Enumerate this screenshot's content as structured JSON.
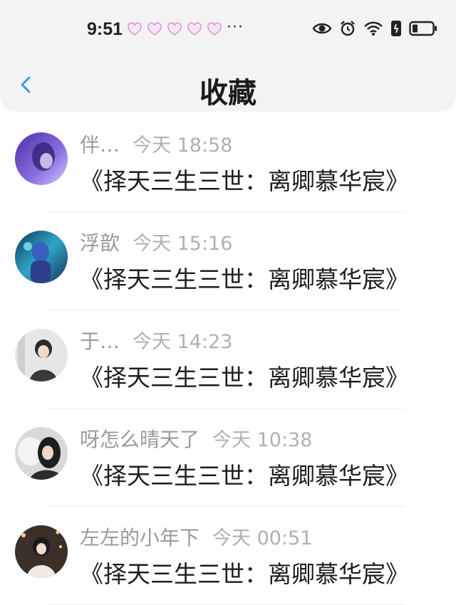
{
  "status_bar": {
    "time": "9:51",
    "more": "···",
    "icons": [
      "eye-icon",
      "alarm-icon",
      "wifi-icon",
      "sim-icon",
      "battery-icon"
    ]
  },
  "header": {
    "title": "收藏",
    "back_icon": "chevron-left-icon",
    "accent": "#3a9bdc"
  },
  "items": [
    {
      "name": "伴…",
      "time": "今天 18:58",
      "content": "《择天三生三世：离卿慕华宸》"
    },
    {
      "name": "浮歆",
      "time": "今天 15:16",
      "content": "《择天三生三世：离卿慕华宸》"
    },
    {
      "name": "于…",
      "time": "今天 14:23",
      "content": "《择天三生三世：离卿慕华宸》"
    },
    {
      "name": "呀怎么晴天了",
      "time": "今天 10:38",
      "content": "《择天三生三世：离卿慕华宸》"
    },
    {
      "name": "左左的小年下",
      "time": "今天 00:51",
      "content": "《择天三生三世：离卿慕华宸》"
    }
  ]
}
